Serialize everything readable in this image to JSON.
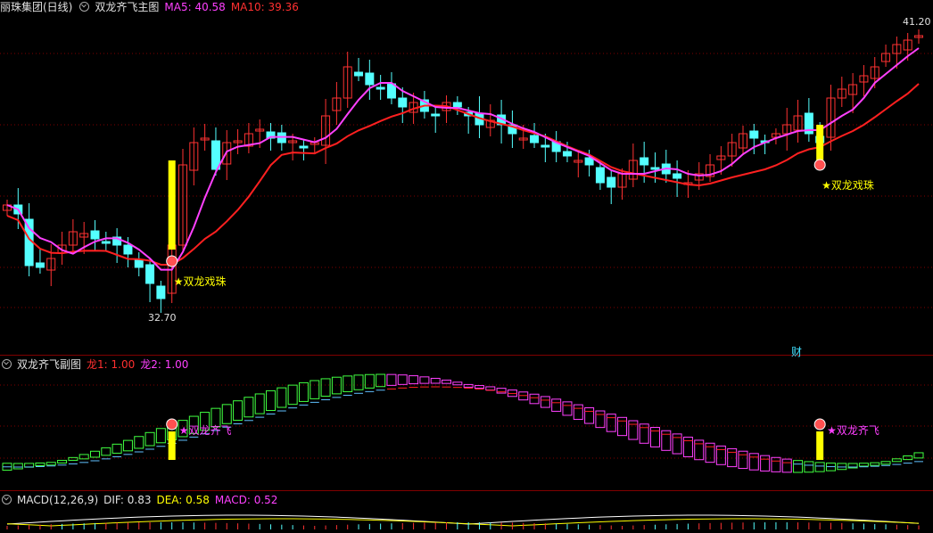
{
  "main_panel": {
    "stock": "丽珠集团(日线)",
    "indicator": "双龙齐飞主图",
    "ma5_label": "MA5: 40.58",
    "ma10_label": "MA10: 39.36",
    "high_price": "41.20",
    "low_price": "32.70",
    "signal_text": "★双龙戏珠",
    "badge": "财"
  },
  "sub_panel": {
    "indicator": "双龙齐飞副图",
    "long1_label": "龙1: 1.00",
    "long2_label": "龙2: 1.00",
    "signal_text": "★双龙齐飞"
  },
  "macd_panel": {
    "name": "MACD(12,26,9)",
    "dif_label": "DIF: 0.83",
    "dea_label": "DEA: 0.58",
    "macd_label": "MACD: 0.52"
  },
  "colors": {
    "up": "#ff3232",
    "down": "#54ffff",
    "ma5": "#ff40ff",
    "ma10": "#ff2020",
    "signal": "#ffff00",
    "grid": "#800000"
  },
  "chart_data": {
    "type": "candlestick",
    "y_axis": "price",
    "low_marker": 32.7,
    "high_marker": 41.2,
    "signal_indices": [
      15,
      74
    ]
  }
}
